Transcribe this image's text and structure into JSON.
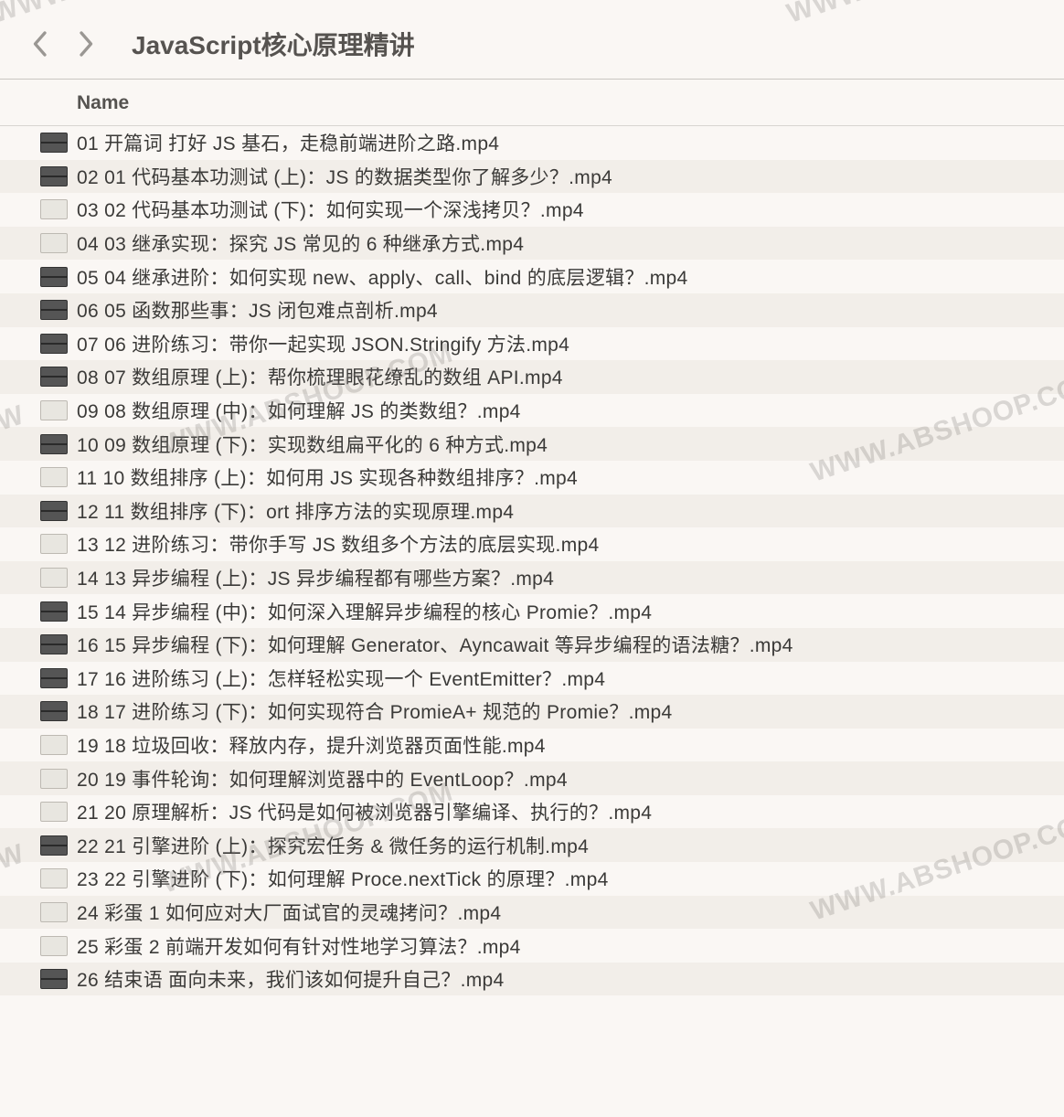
{
  "title": "JavaScript核心原理精讲",
  "columnHeader": "Name",
  "watermark": "WWW.ABSHOOP.COM",
  "watermarkShort": "WWW",
  "files": [
    {
      "name": "01 开篇词  打好 JS 基石，走稳前端进阶之路.mp4",
      "dark": true
    },
    {
      "name": "02 01  代码基本功测试 (上)：JS 的数据类型你了解多少？.mp4",
      "dark": true
    },
    {
      "name": "03 02  代码基本功测试 (下)：如何实现一个深浅拷贝？.mp4",
      "dark": false
    },
    {
      "name": "04 03  继承实现：探究 JS 常见的 6 种继承方式.mp4",
      "dark": false
    },
    {
      "name": "05 04  继承进阶：如何实现 new、apply、call、bind 的底层逻辑？.mp4",
      "dark": true
    },
    {
      "name": "06 05  函数那些事：JS 闭包难点剖析.mp4",
      "dark": true
    },
    {
      "name": "07 06  进阶练习：带你一起实现 JSON.Stringify 方法.mp4",
      "dark": true
    },
    {
      "name": "08 07  数组原理 (上)：帮你梳理眼花缭乱的数组 API.mp4",
      "dark": true
    },
    {
      "name": "09 08  数组原理 (中)：如何理解 JS 的类数组？.mp4",
      "dark": false
    },
    {
      "name": "10 09  数组原理 (下)：实现数组扁平化的 6 种方式.mp4",
      "dark": true
    },
    {
      "name": "11 10  数组排序 (上)：如何用 JS 实现各种数组排序？.mp4",
      "dark": false
    },
    {
      "name": "12 11  数组排序 (下)：ort 排序方法的实现原理.mp4",
      "dark": true
    },
    {
      "name": "13 12  进阶练习：带你手写 JS 数组多个方法的底层实现.mp4",
      "dark": false
    },
    {
      "name": "14 13  异步编程 (上)：JS 异步编程都有哪些方案？.mp4",
      "dark": false
    },
    {
      "name": "15 14  异步编程 (中)：如何深入理解异步编程的核心 Promie？.mp4",
      "dark": true
    },
    {
      "name": "16 15  异步编程 (下)：如何理解 Generator、Ayncawait 等异步编程的语法糖？.mp4",
      "dark": true
    },
    {
      "name": "17 16  进阶练习 (上)：怎样轻松实现一个 EventEmitter？.mp4",
      "dark": true
    },
    {
      "name": "18 17  进阶练习 (下)：如何实现符合 PromieA+ 规范的 Promie？.mp4",
      "dark": true
    },
    {
      "name": "19 18  垃圾回收：释放内存，提升浏览器页面性能.mp4",
      "dark": false
    },
    {
      "name": "20 19  事件轮询：如何理解浏览器中的 EventLoop？.mp4",
      "dark": false
    },
    {
      "name": "21 20  原理解析：JS 代码是如何被浏览器引擎编译、执行的？.mp4",
      "dark": false
    },
    {
      "name": "22 21  引擎进阶 (上)：探究宏任务 & 微任务的运行机制.mp4",
      "dark": true
    },
    {
      "name": "23 22  引擎进阶 (下)：如何理解 Proce.nextTick 的原理？.mp4",
      "dark": false
    },
    {
      "name": "24 彩蛋 1  如何应对大厂面试官的灵魂拷问？.mp4",
      "dark": false
    },
    {
      "name": "25 彩蛋 2  前端开发如何有针对性地学习算法？.mp4",
      "dark": false
    },
    {
      "name": "26 结束语  面向未来，我们该如何提升自己？.mp4",
      "dark": true
    }
  ]
}
